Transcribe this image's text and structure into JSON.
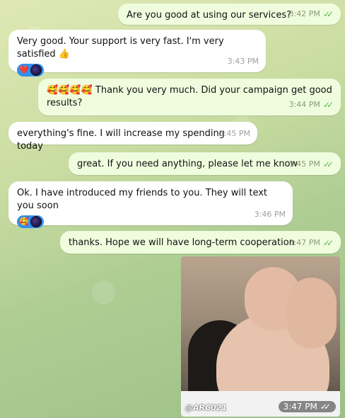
{
  "messages": [
    {
      "text": "Are you good at using our services?",
      "time": "3:42 PM",
      "status": "read-double-check"
    },
    {
      "text": "Very good. Your support is very fast. I'm very satisfied 👍",
      "time": "3:43 PM",
      "reactions": [
        "❤️"
      ]
    },
    {
      "emoji": "🥰🥰🥰🥰",
      "text": "Thank you very much. Did your campaign get good results?",
      "time": "3:44 PM",
      "status": "read-double-check"
    },
    {
      "text": "everything's fine. I will increase my spending today",
      "time": "3:45 PM"
    },
    {
      "text": "great. If you need anything, please let me know",
      "time": "3:45 PM",
      "status": "read-double-check"
    },
    {
      "text": "Ok. I have introduced my friends to you. They will text you soon",
      "time": "3:46 PM",
      "reactions": [
        "🥰"
      ]
    },
    {
      "text": "thanks. Hope we will have long-term cooperation",
      "time": "3:47 PM",
      "status": "read-double-check"
    },
    {
      "photo_watermark": "@ARC021",
      "time": "3:47 PM",
      "status": "read-double-check"
    }
  ],
  "check_glyph": "✓✓",
  "colors": {
    "outgoing": "#effdde",
    "incoming": "#ffffff",
    "reaction_bg": "#3390ec",
    "check": "#5cb85c"
  }
}
